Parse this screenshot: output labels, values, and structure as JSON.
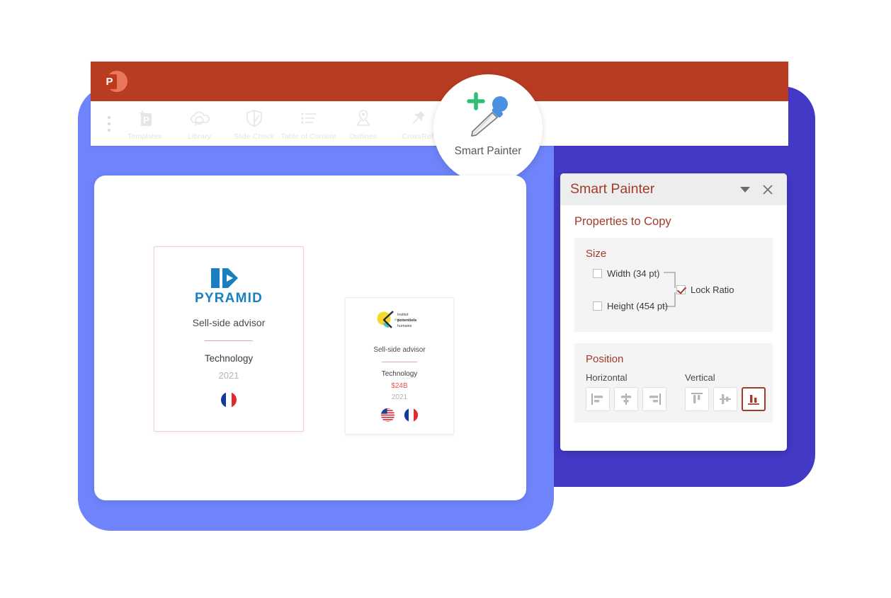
{
  "app": {
    "brand_icon": "powerpoint-logo-icon",
    "titlebar_color": "#b83c22"
  },
  "toolbar": {
    "menu_icon": "kebab-menu-icon",
    "items": [
      {
        "label": "Templates",
        "icon": "template-add-icon"
      },
      {
        "label": "Library",
        "icon": "cloud-search-icon"
      },
      {
        "label": "Slide Check",
        "icon": "shield-check-icon"
      },
      {
        "label": "Table of Content",
        "icon": "list-lines-icon"
      },
      {
        "label": "Outlines",
        "icon": "map-pin-icon"
      },
      {
        "label": "CrossRef",
        "icon": "pushpin-icon"
      }
    ]
  },
  "bubble": {
    "label": "Smart Painter",
    "icon": "eyedropper-plus-icon",
    "plus_color": "#2fbf71",
    "bulb_color": "#4a90e2"
  },
  "cards": {
    "primary": {
      "logo_text": "PYRAMID",
      "logo_color": "#1a7fc1",
      "subtitle": "Sell-side advisor",
      "category": "Technology",
      "year": "2021",
      "flags": [
        "flag-france-icon"
      ]
    },
    "secondary": {
      "logo_lines": [
        "institut",
        "des",
        "potentiels",
        "humains"
      ],
      "subtitle": "Sell-side advisor",
      "category": "Technology",
      "value": "$24B",
      "value_color": "#e8554d",
      "year": "2021",
      "flags": [
        "flag-usa-icon",
        "flag-france-icon"
      ]
    }
  },
  "panel": {
    "title": "Smart Painter",
    "accent_color": "#a33b2a",
    "caret_icon": "chevron-down-icon",
    "close_icon": "close-icon",
    "section_title": "Properties to Copy",
    "size": {
      "heading": "Size",
      "width_label": "Width (34 pt)",
      "width_checked": false,
      "height_label": "Height (454 pt)",
      "height_checked": false,
      "lock_ratio_label": "Lock Ratio",
      "lock_ratio_checked": true
    },
    "position": {
      "heading": "Position",
      "horizontal_label": "Horizontal",
      "vertical_label": "Vertical",
      "horizontal_buttons": [
        {
          "name": "align-left-icon",
          "active": false
        },
        {
          "name": "align-center-icon",
          "active": false
        },
        {
          "name": "align-right-icon",
          "active": false
        }
      ],
      "vertical_buttons": [
        {
          "name": "align-top-icon",
          "active": false
        },
        {
          "name": "align-middle-icon",
          "active": false
        },
        {
          "name": "align-bottom-icon",
          "active": true
        }
      ]
    }
  }
}
